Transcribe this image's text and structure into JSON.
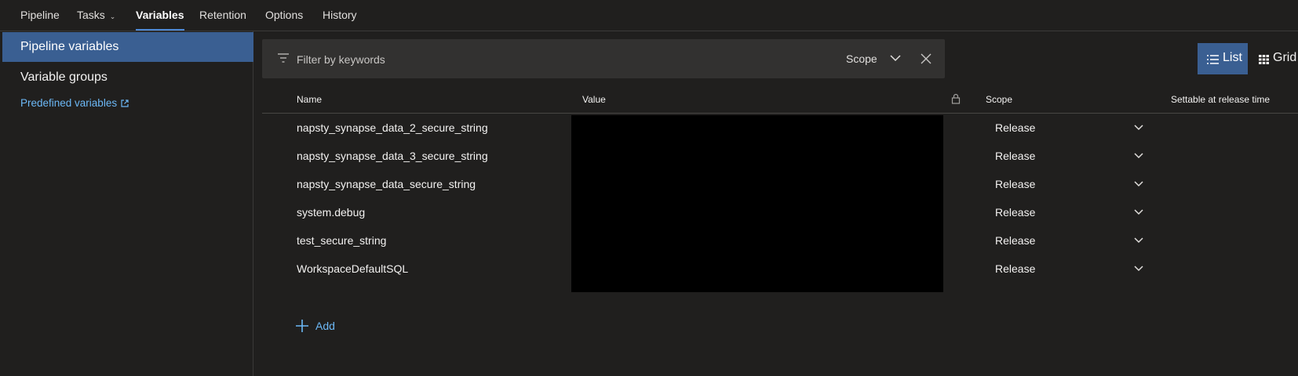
{
  "tabs": [
    {
      "label": "Pipeline"
    },
    {
      "label": "Tasks"
    },
    {
      "label": "Variables"
    },
    {
      "label": "Retention"
    },
    {
      "label": "Options"
    },
    {
      "label": "History"
    }
  ],
  "sidebar": {
    "items": [
      {
        "label": "Pipeline variables"
      },
      {
        "label": "Variable groups"
      }
    ],
    "predefined_link": "Predefined variables"
  },
  "filter": {
    "placeholder": "Filter by keywords",
    "scope_label": "Scope"
  },
  "view_toggle": {
    "list_label": "List",
    "grid_label": "Grid"
  },
  "table": {
    "columns": {
      "name": "Name",
      "value": "Value",
      "scope": "Scope",
      "settable": "Settable at release time"
    },
    "rows": [
      {
        "name": "napsty_synapse_data_2_secure_string",
        "scope": "Release"
      },
      {
        "name": "napsty_synapse_data_3_secure_string",
        "scope": "Release"
      },
      {
        "name": "napsty_synapse_data_secure_string",
        "scope": "Release"
      },
      {
        "name": "system.debug",
        "scope": "Release"
      },
      {
        "name": "test_secure_string",
        "scope": "Release"
      },
      {
        "name": "WorkspaceDefaultSQL",
        "scope": "Release"
      }
    ]
  },
  "add_label": "Add",
  "colors": {
    "background": "#201f1e",
    "selected": "#3a5f92",
    "link": "#6cb8f6",
    "tab_underline": "#4f8ad6"
  }
}
